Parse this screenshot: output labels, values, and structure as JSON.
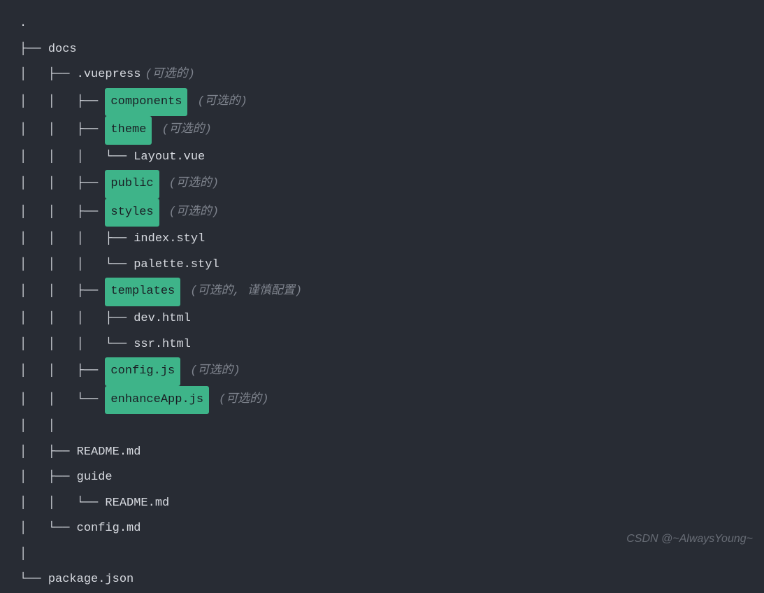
{
  "tree": [
    {
      "prefix": ".",
      "text": "",
      "highlighted": false,
      "comment": ""
    },
    {
      "prefix": "├── ",
      "text": "docs",
      "highlighted": false,
      "comment": ""
    },
    {
      "prefix": "│   ├── ",
      "text": ".vuepress",
      "highlighted": false,
      "comment": "(可选的)"
    },
    {
      "prefix": "│   │   ├── ",
      "text": "components",
      "highlighted": true,
      "comment": "(可选的)"
    },
    {
      "prefix": "│   │   ├── ",
      "text": "theme",
      "highlighted": true,
      "comment": "(可选的)"
    },
    {
      "prefix": "│   │   │   └── ",
      "text": "Layout.vue",
      "highlighted": false,
      "comment": ""
    },
    {
      "prefix": "│   │   ├── ",
      "text": "public",
      "highlighted": true,
      "comment": "(可选的)"
    },
    {
      "prefix": "│   │   ├── ",
      "text": "styles",
      "highlighted": true,
      "comment": "(可选的)"
    },
    {
      "prefix": "│   │   │   ├── ",
      "text": "index.styl",
      "highlighted": false,
      "comment": ""
    },
    {
      "prefix": "│   │   │   └── ",
      "text": "palette.styl",
      "highlighted": false,
      "comment": ""
    },
    {
      "prefix": "│   │   ├── ",
      "text": "templates",
      "highlighted": true,
      "comment": "(可选的, 谨慎配置)"
    },
    {
      "prefix": "│   │   │   ├── ",
      "text": "dev.html",
      "highlighted": false,
      "comment": ""
    },
    {
      "prefix": "│   │   │   └── ",
      "text": "ssr.html",
      "highlighted": false,
      "comment": ""
    },
    {
      "prefix": "│   │   ├── ",
      "text": "config.js",
      "highlighted": true,
      "comment": "(可选的)"
    },
    {
      "prefix": "│   │   └── ",
      "text": "enhanceApp.js",
      "highlighted": true,
      "comment": "(可选的)"
    },
    {
      "prefix": "│   │ ",
      "text": "",
      "highlighted": false,
      "comment": ""
    },
    {
      "prefix": "│   ├── ",
      "text": "README.md",
      "highlighted": false,
      "comment": ""
    },
    {
      "prefix": "│   ├── ",
      "text": "guide",
      "highlighted": false,
      "comment": ""
    },
    {
      "prefix": "│   │   └── ",
      "text": "README.md",
      "highlighted": false,
      "comment": ""
    },
    {
      "prefix": "│   └── ",
      "text": "config.md",
      "highlighted": false,
      "comment": ""
    },
    {
      "prefix": "│ ",
      "text": "",
      "highlighted": false,
      "comment": ""
    },
    {
      "prefix": "└── ",
      "text": "package.json",
      "highlighted": false,
      "comment": ""
    }
  ],
  "watermark": "CSDN @~AlwaysYoung~"
}
